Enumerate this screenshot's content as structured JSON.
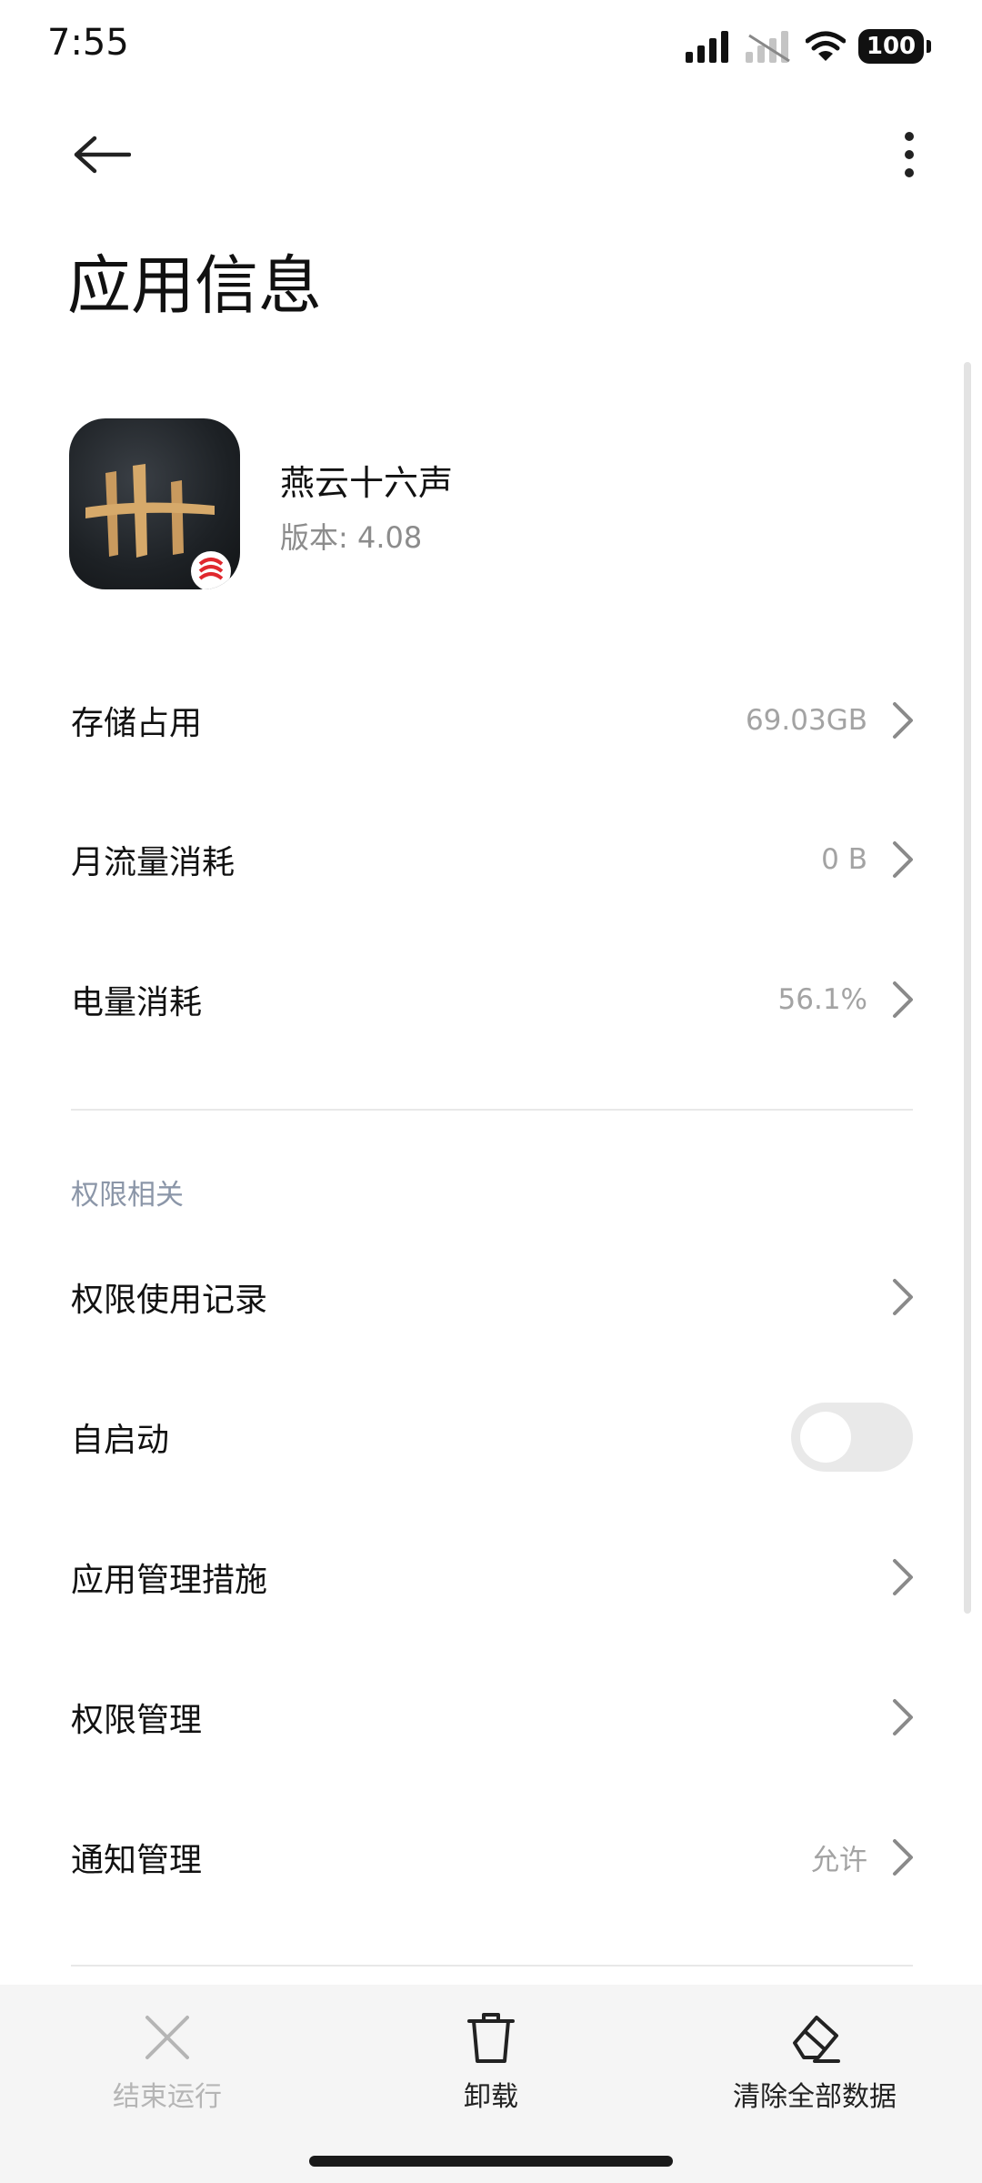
{
  "status_bar": {
    "time": "7:55",
    "battery": "100"
  },
  "header": {
    "title": "应用信息"
  },
  "app": {
    "name": "燕云十六声",
    "version": "版本: 4.08"
  },
  "usage_rows": [
    {
      "label": "存储占用",
      "value": "69.03GB"
    },
    {
      "label": "月流量消耗",
      "value": "0 B"
    },
    {
      "label": "电量消耗",
      "value": "56.1%"
    }
  ],
  "permissions": {
    "section_title": "权限相关",
    "rows": [
      {
        "label": "权限使用记录",
        "value": ""
      },
      {
        "label": "自启动",
        "toggle_on": false
      },
      {
        "label": "应用管理措施",
        "value": ""
      },
      {
        "label": "权限管理",
        "value": ""
      },
      {
        "label": "通知管理",
        "value": "允许"
      }
    ]
  },
  "bottom_bar": {
    "force_stop": "结束运行",
    "uninstall": "卸载",
    "clear_data": "清除全部数据"
  },
  "colors": {
    "text_primary": "#111111",
    "text_secondary": "#a3a3a3",
    "disabled": "#b5b5b5",
    "section_header": "#8b96a8"
  }
}
